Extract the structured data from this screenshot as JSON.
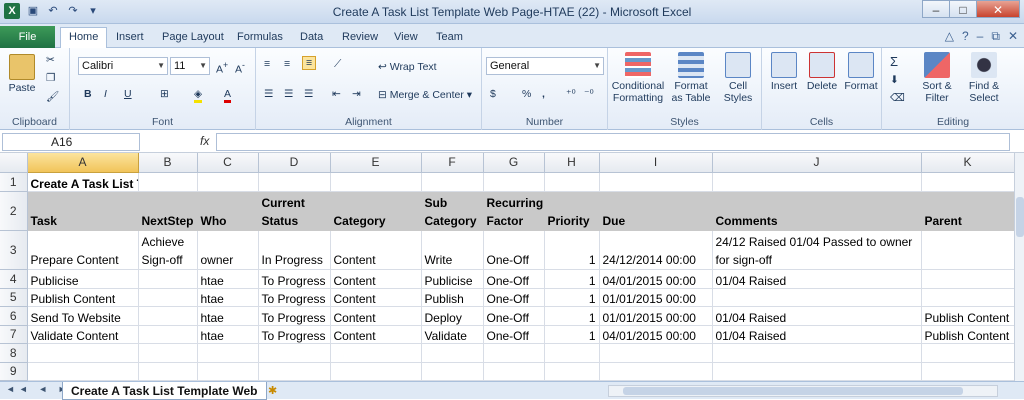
{
  "window": {
    "title": "Create A Task List Template Web Page-HTAE (22)  -  Microsoft Excel"
  },
  "tabs": [
    "File",
    "Home",
    "Insert",
    "Page Layout",
    "Formulas",
    "Data",
    "Review",
    "View",
    "Team"
  ],
  "ribbon": {
    "clipboard": {
      "paste": "Paste",
      "label": "Clipboard"
    },
    "font": {
      "name": "Calibri",
      "size": "11",
      "label": "Font",
      "bold": "B",
      "italic": "I",
      "underline": "U"
    },
    "alignment": {
      "wrap": "Wrap Text",
      "merge": "Merge & Center",
      "label": "Alignment"
    },
    "number": {
      "format": "General",
      "label": "Number",
      "currency": "$",
      "percent": "%",
      "comma": ","
    },
    "styles": {
      "conditional": "Conditional Formatting",
      "format_table": "Format as Table",
      "cell_styles": "Cell Styles",
      "label": "Styles"
    },
    "cells": {
      "insert": "Insert",
      "delete": "Delete",
      "format": "Format",
      "label": "Cells"
    },
    "editing": {
      "sort": "Sort & Filter",
      "find": "Find & Select",
      "label": "Editing",
      "sigma": "Σ"
    }
  },
  "formula_bar": {
    "name_box": "A16",
    "fx": "fx",
    "value": ""
  },
  "columns": [
    "A",
    "B",
    "C",
    "D",
    "E",
    "F",
    "G",
    "H",
    "I",
    "J",
    "K"
  ],
  "selected_column": "A",
  "rows": [
    {
      "n": "1",
      "cells": [
        "Create A Task List Template Web Page",
        "",
        "",
        "",
        "",
        "",
        "",
        "",
        "",
        "",
        ""
      ]
    },
    {
      "n": "2",
      "cells": [
        "Task",
        "NextStep",
        "Who",
        "Current Status",
        "Category",
        "Sub Category",
        "Recurring Factor",
        "Priority",
        "Due",
        "Comments",
        "Parent"
      ]
    },
    {
      "n": "3",
      "cells": [
        "Prepare Content",
        "Achieve Sign-off",
        "owner",
        "In Progress",
        "Content",
        "Write",
        "One-Off",
        "1",
        "24/12/2014 00:00",
        "24/12 Raised 01/04 Passed to owner for sign-off",
        ""
      ]
    },
    {
      "n": "4",
      "cells": [
        "Publicise",
        "",
        "htae",
        "To Progress",
        "Content",
        "Publicise",
        "One-Off",
        "1",
        "04/01/2015 00:00",
        "01/04 Raised",
        ""
      ]
    },
    {
      "n": "5",
      "cells": [
        "Publish Content",
        "",
        "htae",
        "To Progress",
        "Content",
        "Publish",
        "One-Off",
        "1",
        "01/01/2015 00:00",
        "",
        ""
      ]
    },
    {
      "n": "6",
      "cells": [
        "Send To Website",
        "",
        "htae",
        "To Progress",
        "Content",
        "Deploy",
        "One-Off",
        "1",
        "01/01/2015 00:00",
        "01/04 Raised",
        "Publish Content"
      ]
    },
    {
      "n": "7",
      "cells": [
        "Validate Content",
        "",
        "htae",
        "To Progress",
        "Content",
        "Validate",
        "One-Off",
        "1",
        "04/01/2015 00:00",
        "01/04 Raised",
        "Publish Content"
      ]
    },
    {
      "n": "8",
      "cells": [
        "",
        "",
        "",
        "",
        "",
        "",
        "",
        "",
        "",
        "",
        ""
      ]
    },
    {
      "n": "9",
      "cells": [
        "",
        "",
        "",
        "",
        "",
        "",
        "",
        "",
        "",
        "",
        ""
      ]
    }
  ],
  "sheet_tab": "Create A Task List Template Web",
  "colors": {
    "accent": "#1f7244",
    "header_fill": "#c9c9c9",
    "selection": "#f1c45a"
  }
}
